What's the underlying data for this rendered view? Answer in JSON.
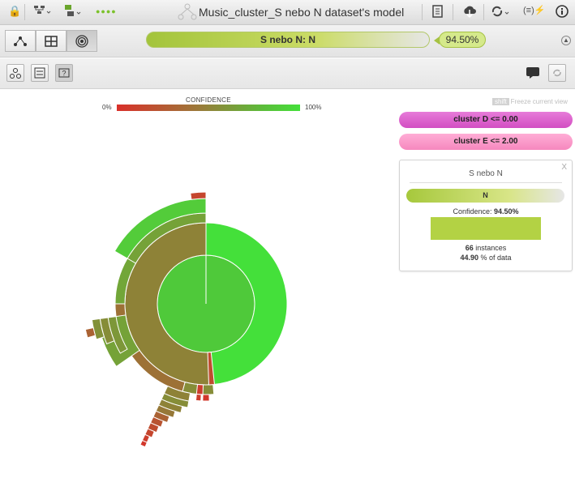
{
  "topbar": {
    "title": "Music_cluster_S nebo N dataset's model",
    "icons": [
      "lock-icon",
      "tree-menu-icon",
      "model-menu-icon",
      "status-dots",
      "report-icon",
      "cloud-download-icon",
      "sync-icon",
      "formula-icon",
      "info-icon"
    ]
  },
  "prediction": {
    "label": "S nebo N: N",
    "percent": "94.50%"
  },
  "confidence_legend": {
    "title": "CONFIDENCE",
    "min": "0%",
    "max": "100%"
  },
  "freeze": {
    "label": "Freeze current view",
    "box": "shift"
  },
  "rules": [
    {
      "label": "cluster D <= 0.00",
      "color": "#d94dc6"
    },
    {
      "label": "cluster E <= 2.00",
      "color": "#f78cc2"
    }
  ],
  "panel": {
    "title": "S nebo N",
    "close": "X",
    "prediction": "N",
    "confidence_label": "Confidence:",
    "confidence_value": "94.50%",
    "instances_count": "66",
    "instances_label": "instances",
    "data_percent": "44.90",
    "data_label": "% of data"
  },
  "colors": {
    "green": "#44e03a",
    "olive": "#8a8a3a",
    "brown": "#a86b38",
    "red": "#d9302a"
  }
}
